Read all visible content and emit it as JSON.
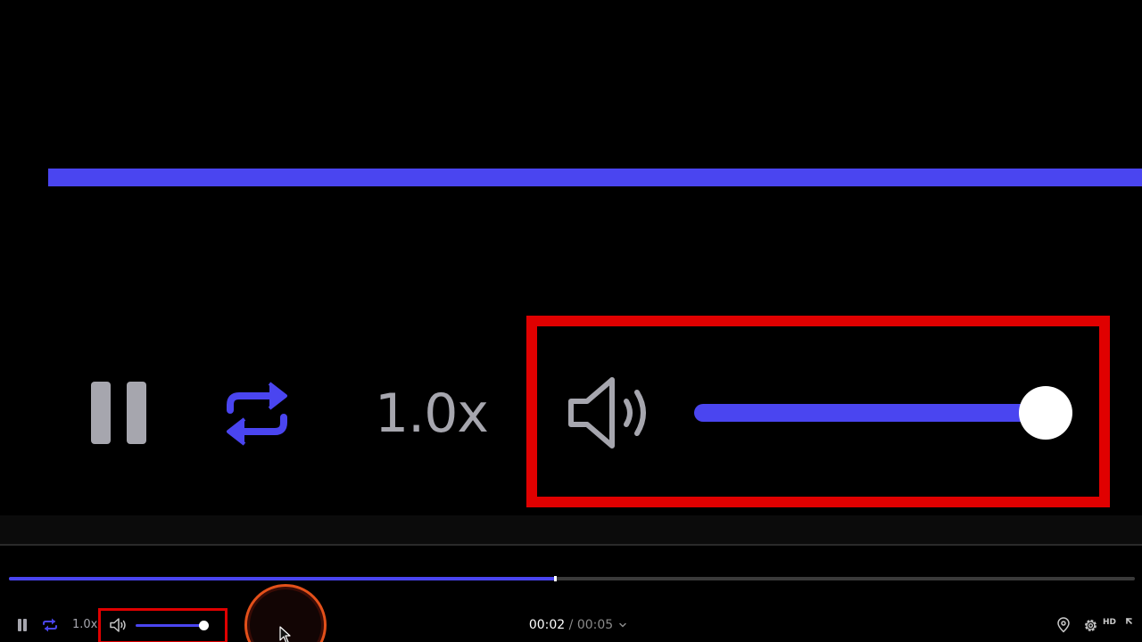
{
  "colors": {
    "accent": "#4a45f0",
    "highlight": "#e00000",
    "click_ring": "#e3501a"
  },
  "zoom": {
    "speed_label": "1.0x"
  },
  "player": {
    "progress_fraction": 0.485,
    "volume_fraction": 1.0,
    "speed_label": "1.0x",
    "time_current": "00:02",
    "time_separator": "/",
    "time_total": "00:05",
    "quality_label": "HD"
  },
  "icons": {
    "pause": "pause-icon",
    "loop": "loop-icon",
    "volume": "volume-icon",
    "location": "map-pin-icon",
    "settings": "gear-icon",
    "fullscreen": "fullscreen-icon",
    "chevron": "chevron-down-icon",
    "cursor": "mouse-cursor-icon"
  }
}
